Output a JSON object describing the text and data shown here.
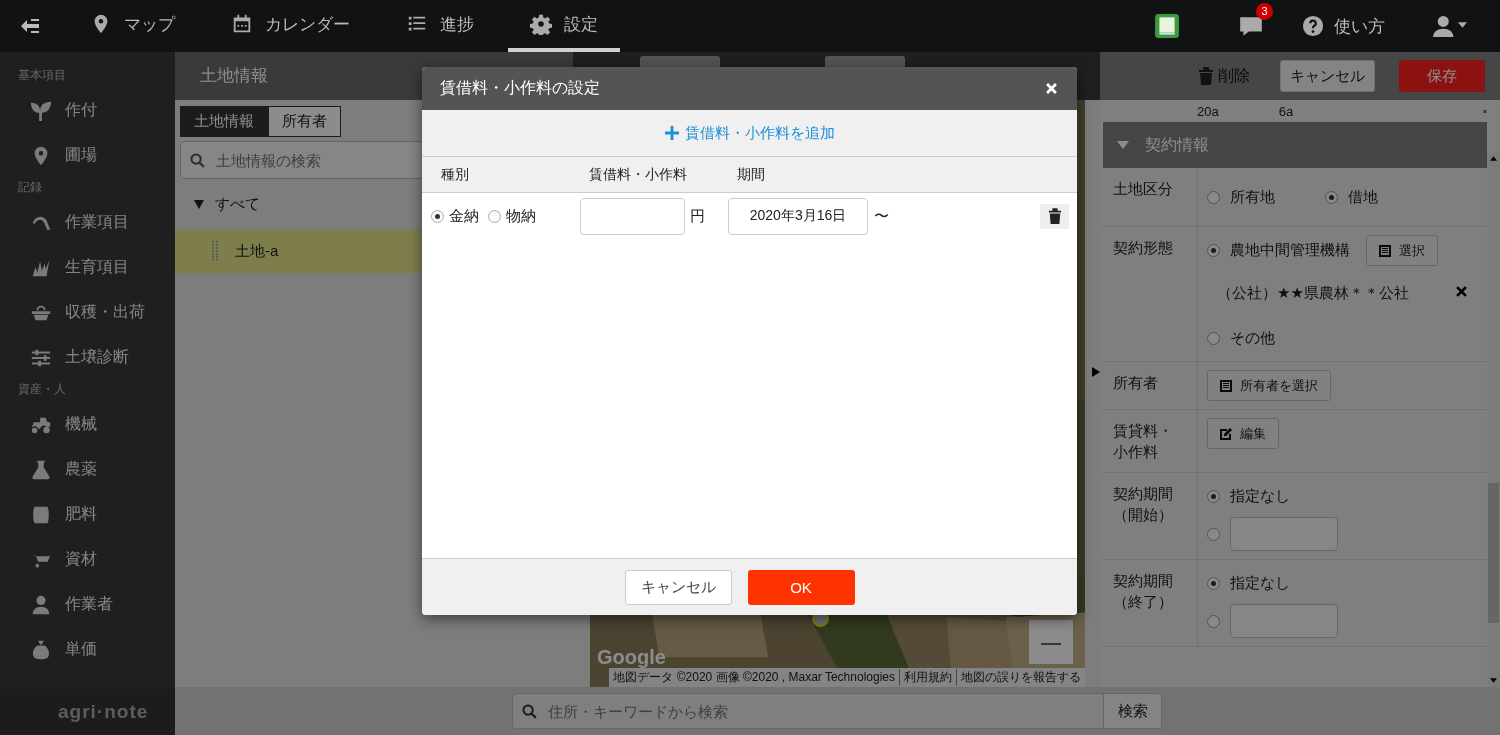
{
  "nav": {
    "items": [
      {
        "label": "マップ",
        "selected": false
      },
      {
        "label": "カレンダー",
        "selected": false
      },
      {
        "label": "進捗",
        "selected": false
      },
      {
        "label": "設定",
        "selected": true
      }
    ],
    "badge": "3",
    "help": "使い方"
  },
  "sidebar": {
    "sections": [
      {
        "heading": "基本項目",
        "items": [
          "作付",
          "圃場"
        ]
      },
      {
        "heading": "記録",
        "items": [
          "作業項目",
          "生育項目",
          "収穫・出荷",
          "土壌診断"
        ]
      },
      {
        "heading": "資産・人",
        "items": [
          "機械",
          "農薬",
          "肥料",
          "資材",
          "作業者",
          "単価"
        ]
      }
    ],
    "logo": "agri·note"
  },
  "land_panel": {
    "title": "土地情報",
    "tabs": [
      {
        "label": "土地情報",
        "selected": true
      },
      {
        "label": "所有者",
        "selected": false
      }
    ],
    "search": {
      "placeholder": "土地情報の検索"
    },
    "tree": [
      {
        "label": "すべて",
        "expanded": true,
        "selected": false,
        "children": [
          {
            "label": "土地-a",
            "selected": true
          }
        ]
      }
    ]
  },
  "map": {
    "logo": "Google",
    "attribution": [
      "地図データ ©2020 画像 ©2020 , Maxar Technologies",
      "利用規約",
      "地図の誤りを報告する"
    ],
    "zoom_out": "—"
  },
  "detail": {
    "toolbar": {
      "delete": "削除",
      "cancel": "キャンセル",
      "save": "保存"
    },
    "cut_row": [
      "20a",
      "6a"
    ],
    "section": {
      "title": "契約情報",
      "expanded": true
    },
    "rows": [
      {
        "label": "土地区分",
        "kind": "radios",
        "options": [
          {
            "label": "所有地",
            "selected": false
          },
          {
            "label": "借地",
            "selected": true
          }
        ]
      },
      {
        "label": "契約形態",
        "kind": "contract",
        "options": [
          {
            "label": "農地中間管理機構",
            "selected": true,
            "button": "選択",
            "value": "（公社）★★県農林＊＊公社"
          },
          {
            "label": "その他",
            "selected": false
          }
        ]
      },
      {
        "label": "所有者",
        "kind": "button",
        "button": "所有者を選択"
      },
      {
        "label": "賃貸料・小作料",
        "kind": "edit",
        "button": "編集"
      },
      {
        "label": "契約期間（開始）",
        "kind": "period",
        "options": [
          {
            "label": "指定なし",
            "selected": true
          },
          {
            "selected": false
          }
        ]
      },
      {
        "label": "契約期間（終了）",
        "kind": "period",
        "options": [
          {
            "label": "指定なし",
            "selected": true
          },
          {
            "selected": false
          }
        ]
      }
    ]
  },
  "bottom_search": {
    "placeholder": "住所・キーワードから検索",
    "button": "検索"
  },
  "modal": {
    "title": "賃借料・小作料の設定",
    "add": "賃借料・小作料を追加",
    "columns": [
      "種別",
      "賃借料・小作料",
      "期間"
    ],
    "rows": [
      {
        "types": [
          {
            "label": "金納",
            "selected": true
          },
          {
            "label": "物納",
            "selected": false
          }
        ],
        "amount": "",
        "unit": "円",
        "start": "2020年3月16日",
        "range": "〜"
      }
    ],
    "cancel": "キャンセル",
    "ok": "OK"
  }
}
